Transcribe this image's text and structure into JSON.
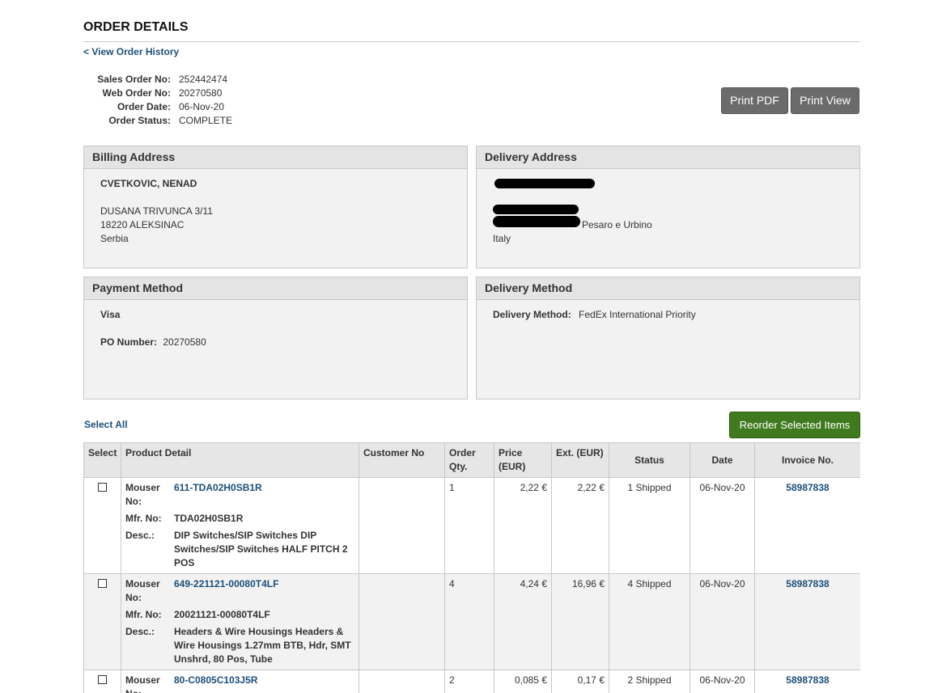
{
  "page": {
    "title": "ORDER DETAILS",
    "back_link": "< View Order History"
  },
  "order": {
    "labels": {
      "sales_order_no": "Sales Order No:",
      "web_order_no": "Web Order No:",
      "order_date": "Order Date:",
      "order_status": "Order Status:"
    },
    "values": {
      "sales_order_no": "252442474",
      "web_order_no": "20270580",
      "order_date": "06-Nov-20",
      "order_status": "COMPLETE"
    }
  },
  "buttons": {
    "print_pdf": "Print PDF",
    "print_view": "Print View",
    "reorder": "Reorder Selected Items",
    "select_all": "Select All"
  },
  "billing": {
    "heading": "Billing Address",
    "name": "CVETKOVIC, NENAD",
    "street": "DUSANA TRIVUNCA 3/11",
    "city": "18220 ALEKSINAC",
    "country": "Serbia"
  },
  "delivery": {
    "heading": "Delivery Address",
    "region": "Pesaro e Urbino",
    "country": "Italy"
  },
  "payment": {
    "heading": "Payment Method",
    "method": "Visa",
    "po_label": "PO Number:",
    "po_value": "20270580"
  },
  "delivery_method": {
    "heading": "Delivery Method",
    "label": "Delivery Method:",
    "value": "FedEx International Priority"
  },
  "table": {
    "headers": {
      "select": "Select",
      "product": "Product Detail",
      "customer_no": "Customer No",
      "order_qty": "Order Qty.",
      "price": "Price (EUR)",
      "ext": "Ext. (EUR)",
      "status": "Status",
      "date": "Date",
      "invoice": "Invoice No."
    },
    "field_labels": {
      "mouser_no": "Mouser No:",
      "mfr_no": "Mfr. No:",
      "desc": "Desc.:"
    },
    "rows": [
      {
        "mouser_no": "611-TDA02H0SB1R",
        "mfr_no": "TDA02H0SB1R",
        "desc": "DIP Switches/SIP Switches DIP Switches/SIP Switches HALF PITCH 2 POS",
        "customer_no": "",
        "qty": "1",
        "price": "2,22 €",
        "ext": "2,22 €",
        "status": "1 Shipped",
        "date": "06-Nov-20",
        "invoice": "58987838"
      },
      {
        "mouser_no": "649-221121-00080T4LF",
        "mfr_no": "20021121-00080T4LF",
        "desc": "Headers & Wire Housings Headers & Wire Housings 1.27mm BTB, Hdr, SMT Unshrd, 80 Pos, Tube",
        "customer_no": "",
        "qty": "4",
        "price": "4,24 €",
        "ext": "16,96 €",
        "status": "4 Shipped",
        "date": "06-Nov-20",
        "invoice": "58987838"
      },
      {
        "mouser_no": "80-C0805C103J5R",
        "mfr_no": "",
        "desc": "",
        "customer_no": "",
        "qty": "2",
        "price": "0,085 €",
        "ext": "0,17 €",
        "status": "2 Shipped",
        "date": "06-Nov-20",
        "invoice": "58987838"
      }
    ]
  }
}
